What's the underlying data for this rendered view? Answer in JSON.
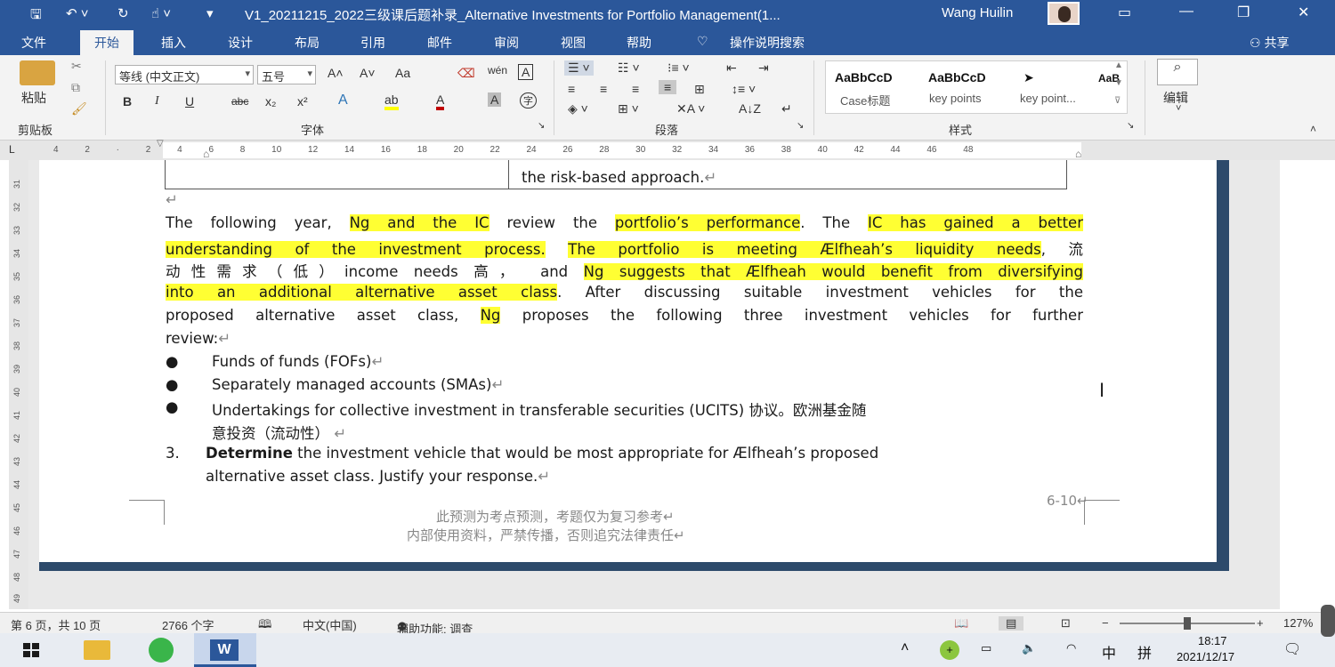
{
  "titlebar": {
    "save_icon": "save-icon",
    "undo_icon": "undo-icon",
    "redo_icon": "redo-icon",
    "touch_icon": "touch-mode-icon",
    "customize_icon": "customize-toolbar-icon",
    "doc_title": "V1_20211215_2022三级课后题补录_Alternative Investments for Portfolio Management(1...",
    "user_name": "Wang Huilin",
    "ribbon_display_icon": "ribbon-display-options-icon",
    "minimize_icon": "minimize-icon",
    "restore_icon": "restore-icon",
    "close_icon": "close-icon"
  },
  "tabs": [
    "文件",
    "开始",
    "插入",
    "设计",
    "布局",
    "引用",
    "邮件",
    "审阅",
    "视图",
    "帮助"
  ],
  "active_tab": "开始",
  "tell_me": "操作说明搜索",
  "share": "共享",
  "ribbon": {
    "clipboard": {
      "paste": "粘贴",
      "label": "剪贴板"
    },
    "font": {
      "font_name": "等线 (中文正文)",
      "font_size": "五号",
      "grow": "A˄",
      "shrink": "A˅",
      "change_case": "Aa",
      "pinyin": "wén",
      "border_char": "A",
      "bold": "B",
      "italic": "I",
      "underline": "U",
      "strike": "abc",
      "sub": "x₂",
      "sup": "x²",
      "text_effect": "A",
      "highlight": "ab",
      "font_color": "A",
      "shading": "A",
      "enclose": "字",
      "label": "字体"
    },
    "paragraph": {
      "label": "段落"
    },
    "styles": {
      "items": [
        {
          "preview": "AaBbCcD",
          "name": "Case标题"
        },
        {
          "preview": "AaBbCcD",
          "name": "key points"
        },
        {
          "preview": "➤",
          "name": "key point..."
        },
        {
          "preview": "AaB",
          "name": ""
        }
      ],
      "label": "样式"
    },
    "editing": {
      "label": "编辑"
    }
  },
  "ruler": {
    "corner": "L",
    "ticks": "4  2  ·  2  4  6  8  10  12  14  16  18  20  22  24  26  28  30  32  34  36  38  40  42  44  46  48",
    "vticks": [
      "31",
      "32",
      "33",
      "34",
      "35",
      "36",
      "37",
      "38",
      "39",
      "40",
      "41",
      "42",
      "43",
      "44",
      "45",
      "46",
      "47",
      "48",
      "49"
    ]
  },
  "document": {
    "table_cell_text": "the risk-based approach.",
    "para1_lines": [
      [
        {
          "t": "The following year, ",
          "h": false
        },
        {
          "t": "Ng and the IC",
          "h": true
        },
        {
          "t": " review the ",
          "h": false
        },
        {
          "t": "portfolio’s performance",
          "h": true
        },
        {
          "t": ". The ",
          "h": false
        },
        {
          "t": "IC has gained a better",
          "h": true
        }
      ],
      [
        {
          "t": "understanding of the investment process.",
          "h": true
        },
        {
          "t": " ",
          "h": false
        },
        {
          "t": "The portfolio is meeting Ælfheah’s liquidity needs",
          "h": true
        },
        {
          "t": ", 流",
          "h": false
        }
      ],
      [
        {
          "t": "动性需求（低）income needs  高，  and ",
          "h": false
        },
        {
          "t": "Ng suggests that Ælfheah would benefit from diversifying",
          "h": true
        }
      ],
      [
        {
          "t": "into an additional alternative asset class",
          "h": true
        },
        {
          "t": ". After discussing suitable investment vehicles for the",
          "h": false
        }
      ],
      [
        {
          "t": "proposed alternative asset class, ",
          "h": false
        },
        {
          "t": "Ng",
          "h": true
        },
        {
          "t": " proposes the following three investment vehicles for further",
          "h": false
        }
      ],
      [
        {
          "t": "review:",
          "h": false
        }
      ]
    ],
    "bullets": [
      "Funds of funds (FOFs)",
      "Separately managed accounts (SMAs)",
      "Undertakings for collective investment in transferable securities (UCITS)  协议。欧洲基金随"
    ],
    "bullet3_cont": "意投资（流动性）",
    "q_number": "3.",
    "q_bold": "Determine",
    "q_line1": " the investment vehicle that would be most appropriate for Ælfheah’s proposed",
    "q_line2": "alternative asset class. Justify your response.",
    "page_ref": "6-10",
    "footer1": "此预测为考点预测，考题仅为复习参考",
    "footer2": "内部使用资料，严禁传播，否则追究法律责任"
  },
  "status": {
    "page": "第 6 页，共 10 页",
    "words": "2766 个字",
    "lang": "中文(中国)",
    "access": "辅助功能: 调查",
    "zoom": "127%",
    "zoom_level": 1.27
  },
  "taskbar": {
    "time": "18:17",
    "date": "2021/12/17",
    "ime": "中",
    "ime2": "拼"
  },
  "colors": {
    "accent": "#2b579a",
    "highlight": "#ffff33"
  }
}
